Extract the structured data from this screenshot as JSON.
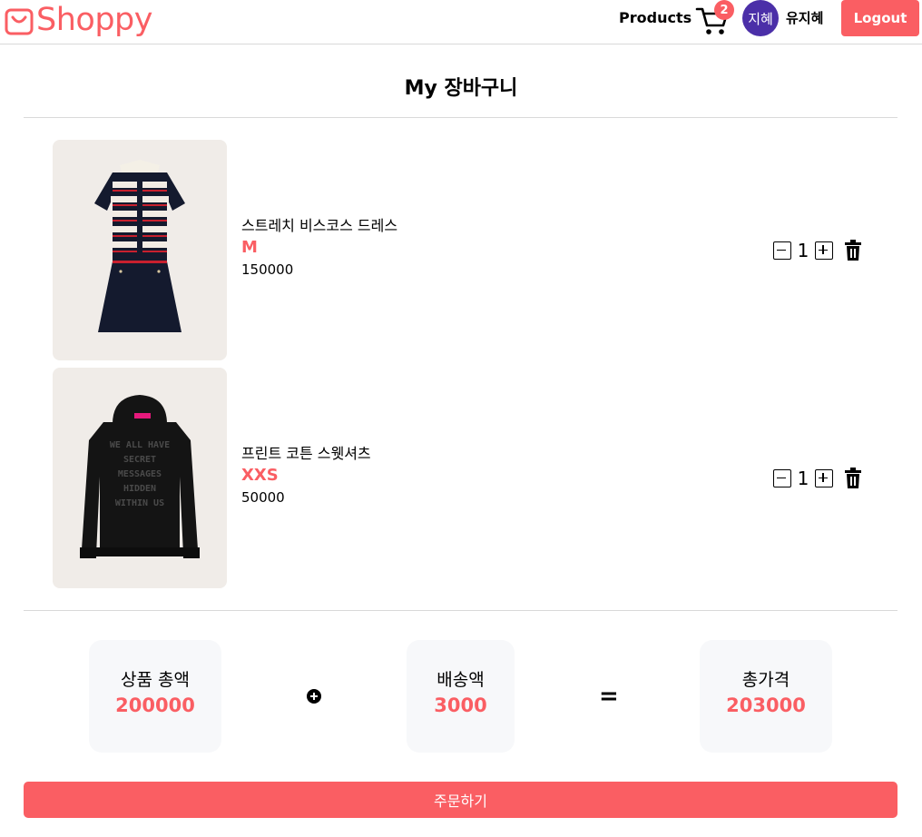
{
  "header": {
    "logo_text": "Shoppy",
    "nav_products": "Products",
    "cart_count": "2",
    "avatar_text": "지혜",
    "username": "유지혜",
    "logout_label": "Logout"
  },
  "page_title": "My 장바구니",
  "cart_items": [
    {
      "name": "스트레치 비스코스 드레스",
      "option": "M",
      "price": "150000",
      "quantity": "1"
    },
    {
      "name": "프린트 코튼 스웻셔츠",
      "option": "XXS",
      "price": "50000",
      "quantity": "1"
    }
  ],
  "hoodie_print": [
    "WE ALL HAVE",
    "SECRET",
    "MESSAGES",
    "HIDDEN",
    "WITHIN US"
  ],
  "summary": {
    "subtotal_label": "상품 총액",
    "subtotal_value": "200000",
    "shipping_label": "배송액",
    "shipping_value": "3000",
    "equals_symbol": "=",
    "total_label": "총가격",
    "total_value": "203000"
  },
  "order_button_label": "주문하기",
  "colors": {
    "accent": "#fa5e63",
    "avatar": "#4b2fa8",
    "summary_bg": "#f7f8fa",
    "thumb_bg": "#f0ece8"
  },
  "icons": [
    "shopping-bag-icon",
    "cart-icon",
    "minus-icon",
    "plus-icon",
    "trash-icon",
    "plus-circle-icon"
  ]
}
